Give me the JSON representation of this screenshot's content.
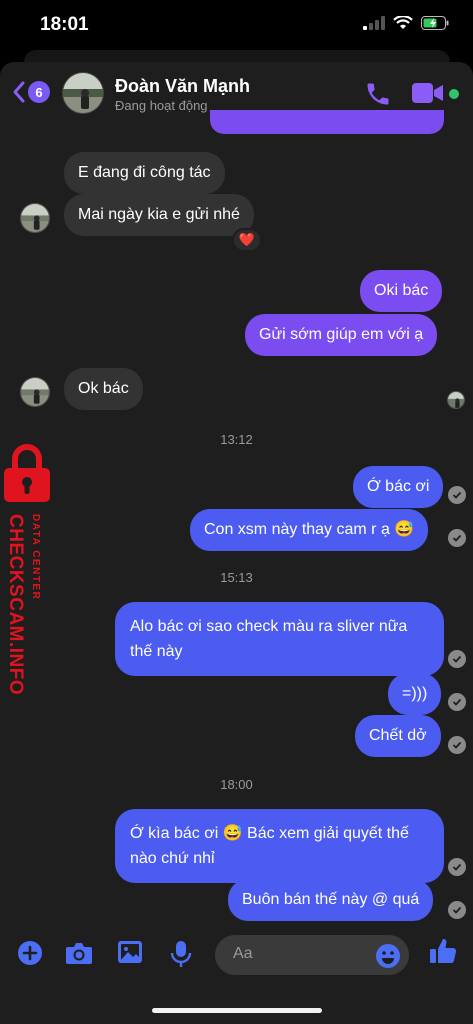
{
  "status_bar": {
    "time": "18:01"
  },
  "header": {
    "unread_count": "6",
    "contact_name": "Đoàn Văn Mạnh",
    "contact_status": "Đang hoạt động",
    "accent_color": "#8b5cf6",
    "icons": [
      "chevron-left-icon",
      "phone-icon",
      "video-camera-icon"
    ]
  },
  "messages": {
    "m1": "E đang đi công tác",
    "m2": "Mai ngày kia e gửi nhé",
    "m2_reaction": "❤️",
    "m3": "Oki bác",
    "m4": "Gửi sớm giúp em với ạ",
    "m5": "Ok bác",
    "t1": "13:12",
    "m6": "Ớ bác ơi",
    "m7": "Con xsm này thay cam r ạ 😅",
    "t2": "15:13",
    "m8": "Alo bác ơi sao check màu ra sliver nữa thế này",
    "m9": "=)))",
    "m10": "Chết dở",
    "t3": "18:00",
    "m11": "Ớ kìa bác ơi 😅 Bác xem giải quyết thế nào chứ nhỉ",
    "m12": "Buôn bán thế này @ quá"
  },
  "watermark": {
    "main": "CHECKSCAM.INFO",
    "sub": "DATA CENTER",
    "color": "#e0141e"
  },
  "composer": {
    "placeholder": "Aa",
    "icons": [
      "plus-icon",
      "camera-icon",
      "image-icon",
      "microphone-icon",
      "emoji-icon",
      "thumbs-up-icon"
    ],
    "accent_color": "#4c6ef5"
  }
}
